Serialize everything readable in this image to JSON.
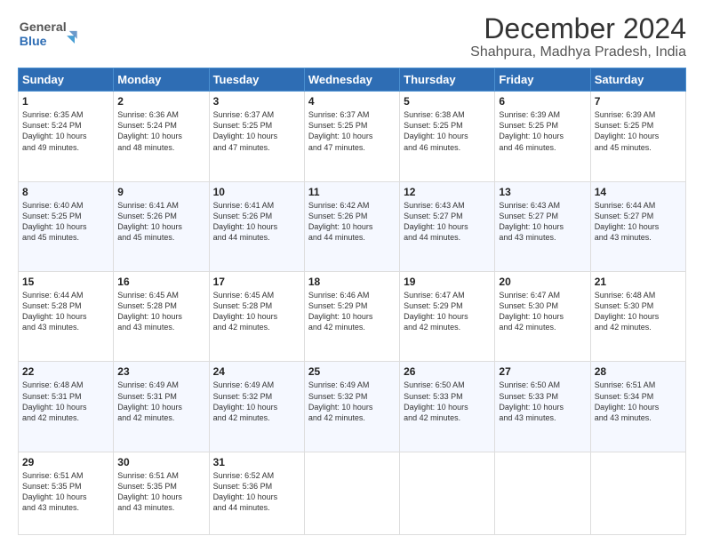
{
  "header": {
    "logo_general": "General",
    "logo_blue": "Blue",
    "title": "December 2024",
    "subtitle": "Shahpura, Madhya Pradesh, India"
  },
  "weekdays": [
    "Sunday",
    "Monday",
    "Tuesday",
    "Wednesday",
    "Thursday",
    "Friday",
    "Saturday"
  ],
  "weeks": [
    [
      {
        "day": "1",
        "info": "Sunrise: 6:35 AM\nSunset: 5:24 PM\nDaylight: 10 hours\nand 49 minutes."
      },
      {
        "day": "2",
        "info": "Sunrise: 6:36 AM\nSunset: 5:24 PM\nDaylight: 10 hours\nand 48 minutes."
      },
      {
        "day": "3",
        "info": "Sunrise: 6:37 AM\nSunset: 5:25 PM\nDaylight: 10 hours\nand 47 minutes."
      },
      {
        "day": "4",
        "info": "Sunrise: 6:37 AM\nSunset: 5:25 PM\nDaylight: 10 hours\nand 47 minutes."
      },
      {
        "day": "5",
        "info": "Sunrise: 6:38 AM\nSunset: 5:25 PM\nDaylight: 10 hours\nand 46 minutes."
      },
      {
        "day": "6",
        "info": "Sunrise: 6:39 AM\nSunset: 5:25 PM\nDaylight: 10 hours\nand 46 minutes."
      },
      {
        "day": "7",
        "info": "Sunrise: 6:39 AM\nSunset: 5:25 PM\nDaylight: 10 hours\nand 45 minutes."
      }
    ],
    [
      {
        "day": "8",
        "info": "Sunrise: 6:40 AM\nSunset: 5:25 PM\nDaylight: 10 hours\nand 45 minutes."
      },
      {
        "day": "9",
        "info": "Sunrise: 6:41 AM\nSunset: 5:26 PM\nDaylight: 10 hours\nand 45 minutes."
      },
      {
        "day": "10",
        "info": "Sunrise: 6:41 AM\nSunset: 5:26 PM\nDaylight: 10 hours\nand 44 minutes."
      },
      {
        "day": "11",
        "info": "Sunrise: 6:42 AM\nSunset: 5:26 PM\nDaylight: 10 hours\nand 44 minutes."
      },
      {
        "day": "12",
        "info": "Sunrise: 6:43 AM\nSunset: 5:27 PM\nDaylight: 10 hours\nand 44 minutes."
      },
      {
        "day": "13",
        "info": "Sunrise: 6:43 AM\nSunset: 5:27 PM\nDaylight: 10 hours\nand 43 minutes."
      },
      {
        "day": "14",
        "info": "Sunrise: 6:44 AM\nSunset: 5:27 PM\nDaylight: 10 hours\nand 43 minutes."
      }
    ],
    [
      {
        "day": "15",
        "info": "Sunrise: 6:44 AM\nSunset: 5:28 PM\nDaylight: 10 hours\nand 43 minutes."
      },
      {
        "day": "16",
        "info": "Sunrise: 6:45 AM\nSunset: 5:28 PM\nDaylight: 10 hours\nand 43 minutes."
      },
      {
        "day": "17",
        "info": "Sunrise: 6:45 AM\nSunset: 5:28 PM\nDaylight: 10 hours\nand 42 minutes."
      },
      {
        "day": "18",
        "info": "Sunrise: 6:46 AM\nSunset: 5:29 PM\nDaylight: 10 hours\nand 42 minutes."
      },
      {
        "day": "19",
        "info": "Sunrise: 6:47 AM\nSunset: 5:29 PM\nDaylight: 10 hours\nand 42 minutes."
      },
      {
        "day": "20",
        "info": "Sunrise: 6:47 AM\nSunset: 5:30 PM\nDaylight: 10 hours\nand 42 minutes."
      },
      {
        "day": "21",
        "info": "Sunrise: 6:48 AM\nSunset: 5:30 PM\nDaylight: 10 hours\nand 42 minutes."
      }
    ],
    [
      {
        "day": "22",
        "info": "Sunrise: 6:48 AM\nSunset: 5:31 PM\nDaylight: 10 hours\nand 42 minutes."
      },
      {
        "day": "23",
        "info": "Sunrise: 6:49 AM\nSunset: 5:31 PM\nDaylight: 10 hours\nand 42 minutes."
      },
      {
        "day": "24",
        "info": "Sunrise: 6:49 AM\nSunset: 5:32 PM\nDaylight: 10 hours\nand 42 minutes."
      },
      {
        "day": "25",
        "info": "Sunrise: 6:49 AM\nSunset: 5:32 PM\nDaylight: 10 hours\nand 42 minutes."
      },
      {
        "day": "26",
        "info": "Sunrise: 6:50 AM\nSunset: 5:33 PM\nDaylight: 10 hours\nand 42 minutes."
      },
      {
        "day": "27",
        "info": "Sunrise: 6:50 AM\nSunset: 5:33 PM\nDaylight: 10 hours\nand 43 minutes."
      },
      {
        "day": "28",
        "info": "Sunrise: 6:51 AM\nSunset: 5:34 PM\nDaylight: 10 hours\nand 43 minutes."
      }
    ],
    [
      {
        "day": "29",
        "info": "Sunrise: 6:51 AM\nSunset: 5:35 PM\nDaylight: 10 hours\nand 43 minutes."
      },
      {
        "day": "30",
        "info": "Sunrise: 6:51 AM\nSunset: 5:35 PM\nDaylight: 10 hours\nand 43 minutes."
      },
      {
        "day": "31",
        "info": "Sunrise: 6:52 AM\nSunset: 5:36 PM\nDaylight: 10 hours\nand 44 minutes."
      },
      null,
      null,
      null,
      null
    ]
  ]
}
